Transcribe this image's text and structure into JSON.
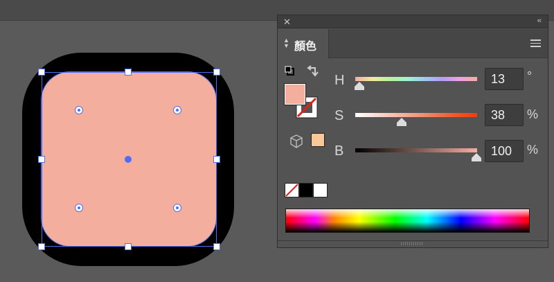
{
  "canvas": {
    "shape_fill": "#f4ae9e",
    "outer_fill": "#000000",
    "selection_color": "#4f6df5"
  },
  "color_panel": {
    "close_icon": "close-icon",
    "collapse_label": "‹‹",
    "tab_label": "顏色",
    "menu_icon": "hamburger-menu-icon",
    "fill_color": "#f4ae9e",
    "stroke": "none",
    "out_of_gamut_swatch": "#f9c89a",
    "sliders": [
      {
        "label": "H",
        "value": "13",
        "unit": "°",
        "fraction": 0.04,
        "gradient": "hue"
      },
      {
        "label": "S",
        "value": "38",
        "unit": "%",
        "fraction": 0.38,
        "gradient": "saturation"
      },
      {
        "label": "B",
        "value": "100",
        "unit": "%",
        "fraction": 1.0,
        "gradient": "brightness"
      }
    ],
    "quick_swatches": [
      "none",
      "#000000",
      "#ffffff"
    ]
  }
}
